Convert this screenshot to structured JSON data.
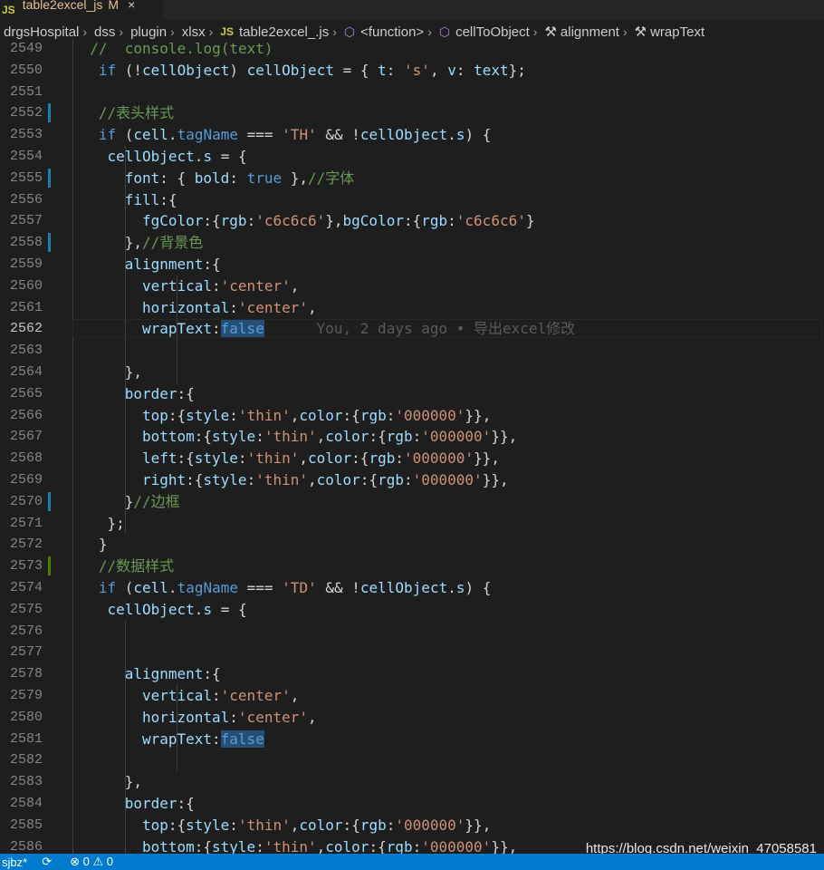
{
  "tab": {
    "badge": "JS",
    "file_name": "table2excel_js",
    "modified_flag": "M",
    "close_glyph": "×"
  },
  "breadcrumb": [
    {
      "label": "drgsHospital",
      "icon": ""
    },
    {
      "label": "dss",
      "icon": ""
    },
    {
      "label": "plugin",
      "icon": ""
    },
    {
      "label": "xlsx",
      "icon": ""
    },
    {
      "label": "table2excel_.js",
      "icon": "js-icon"
    },
    {
      "label": "<function>",
      "icon": "cube-icon"
    },
    {
      "label": "cellToObject",
      "icon": "cube-icon"
    },
    {
      "label": "alignment",
      "icon": "wrench-icon"
    },
    {
      "label": "wrapText",
      "icon": "wrench-icon"
    }
  ],
  "breadcrumb_js_badge": "JS",
  "active_line": "2562",
  "blame": "You, 2 days ago • 导出excel修改",
  "lines": [
    {
      "n": "2549",
      "t": [
        [
          "cmt",
          "//  console.log(text)"
        ]
      ]
    },
    {
      "n": "2550",
      "t": [
        [
          "kw",
          "if"
        ],
        [
          "pun",
          " (!"
        ],
        [
          "var",
          "cellObject"
        ],
        [
          "pun",
          ") "
        ],
        [
          "var",
          "cellObject"
        ],
        [
          "pun",
          " = { "
        ],
        [
          "var",
          "t"
        ],
        [
          "pun",
          ": "
        ],
        [
          "str",
          "'s'"
        ],
        [
          "pun",
          ", "
        ],
        [
          "var",
          "v"
        ],
        [
          "pun",
          ": "
        ],
        [
          "var",
          "text"
        ],
        [
          "pun",
          "};"
        ]
      ]
    },
    {
      "n": "2551",
      "t": []
    },
    {
      "n": "2552",
      "t": [
        [
          "cmt",
          "//表头样式"
        ]
      ]
    },
    {
      "n": "2553",
      "t": [
        [
          "kw",
          "if"
        ],
        [
          "pun",
          " ("
        ],
        [
          "var",
          "cell"
        ],
        [
          "pun",
          "."
        ],
        [
          "kw",
          "tagName"
        ],
        [
          "pun",
          " === "
        ],
        [
          "str",
          "'TH'"
        ],
        [
          "pun",
          " && !"
        ],
        [
          "var",
          "cellObject"
        ],
        [
          "pun",
          "."
        ],
        [
          "var",
          "s"
        ],
        [
          "pun",
          ") {"
        ]
      ]
    },
    {
      "n": "2554",
      "t": [
        [
          "var",
          "cellObject"
        ],
        [
          "pun",
          "."
        ],
        [
          "var",
          "s"
        ],
        [
          "pun",
          " = {"
        ]
      ]
    },
    {
      "n": "2555",
      "t": [
        [
          "var",
          "font"
        ],
        [
          "pun",
          ": { "
        ],
        [
          "var",
          "bold"
        ],
        [
          "pun",
          ": "
        ],
        [
          "kw",
          "true"
        ],
        [
          "pun",
          " },"
        ],
        [
          "cmt",
          "//字体"
        ]
      ]
    },
    {
      "n": "2556",
      "t": [
        [
          "var",
          "fill"
        ],
        [
          "pun",
          ":{"
        ]
      ]
    },
    {
      "n": "2557",
      "t": [
        [
          "var",
          "fgColor"
        ],
        [
          "pun",
          ":{"
        ],
        [
          "var",
          "rgb"
        ],
        [
          "pun",
          ":"
        ],
        [
          "str",
          "'c6c6c6'"
        ],
        [
          "pun",
          "},"
        ],
        [
          "var",
          "bgColor"
        ],
        [
          "pun",
          ":{"
        ],
        [
          "var",
          "rgb"
        ],
        [
          "pun",
          ":"
        ],
        [
          "str",
          "'c6c6c6'"
        ],
        [
          "pun",
          "}"
        ]
      ]
    },
    {
      "n": "2558",
      "t": [
        [
          "pun",
          "},"
        ],
        [
          "cmt",
          "//背景色"
        ]
      ]
    },
    {
      "n": "2559",
      "t": [
        [
          "var",
          "alignment"
        ],
        [
          "pun",
          ":{"
        ]
      ]
    },
    {
      "n": "2560",
      "t": [
        [
          "var",
          "vertical"
        ],
        [
          "pun",
          ":"
        ],
        [
          "str",
          "'center'"
        ],
        [
          "pun",
          ","
        ]
      ]
    },
    {
      "n": "2561",
      "t": [
        [
          "var",
          "horizontal"
        ],
        [
          "pun",
          ":"
        ],
        [
          "str",
          "'center'"
        ],
        [
          "pun",
          ","
        ]
      ]
    },
    {
      "n": "2562",
      "t": [
        [
          "var",
          "wrapText"
        ],
        [
          "pun",
          ":"
        ],
        [
          "selkw",
          "false"
        ]
      ]
    },
    {
      "n": "2563",
      "t": []
    },
    {
      "n": "2564",
      "t": [
        [
          "pun",
          "},"
        ]
      ]
    },
    {
      "n": "2565",
      "t": [
        [
          "var",
          "border"
        ],
        [
          "pun",
          ":{"
        ]
      ]
    },
    {
      "n": "2566",
      "t": [
        [
          "var",
          "top"
        ],
        [
          "pun",
          ":{"
        ],
        [
          "var",
          "style"
        ],
        [
          "pun",
          ":"
        ],
        [
          "str",
          "'thin'"
        ],
        [
          "pun",
          ","
        ],
        [
          "var",
          "color"
        ],
        [
          "pun",
          ":{"
        ],
        [
          "var",
          "rgb"
        ],
        [
          "pun",
          ":"
        ],
        [
          "str",
          "'000000'"
        ],
        [
          "pun",
          "}},"
        ]
      ]
    },
    {
      "n": "2567",
      "t": [
        [
          "var",
          "bottom"
        ],
        [
          "pun",
          ":{"
        ],
        [
          "var",
          "style"
        ],
        [
          "pun",
          ":"
        ],
        [
          "str",
          "'thin'"
        ],
        [
          "pun",
          ","
        ],
        [
          "var",
          "color"
        ],
        [
          "pun",
          ":{"
        ],
        [
          "var",
          "rgb"
        ],
        [
          "pun",
          ":"
        ],
        [
          "str",
          "'000000'"
        ],
        [
          "pun",
          "}},"
        ]
      ]
    },
    {
      "n": "2568",
      "t": [
        [
          "var",
          "left"
        ],
        [
          "pun",
          ":{"
        ],
        [
          "var",
          "style"
        ],
        [
          "pun",
          ":"
        ],
        [
          "str",
          "'thin'"
        ],
        [
          "pun",
          ","
        ],
        [
          "var",
          "color"
        ],
        [
          "pun",
          ":{"
        ],
        [
          "var",
          "rgb"
        ],
        [
          "pun",
          ":"
        ],
        [
          "str",
          "'000000'"
        ],
        [
          "pun",
          "}},"
        ]
      ]
    },
    {
      "n": "2569",
      "t": [
        [
          "var",
          "right"
        ],
        [
          "pun",
          ":{"
        ],
        [
          "var",
          "style"
        ],
        [
          "pun",
          ":"
        ],
        [
          "str",
          "'thin'"
        ],
        [
          "pun",
          ","
        ],
        [
          "var",
          "color"
        ],
        [
          "pun",
          ":{"
        ],
        [
          "var",
          "rgb"
        ],
        [
          "pun",
          ":"
        ],
        [
          "str",
          "'000000'"
        ],
        [
          "pun",
          "}},"
        ]
      ]
    },
    {
      "n": "2570",
      "t": [
        [
          "pun",
          "}"
        ],
        [
          "cmt",
          "//边框"
        ]
      ]
    },
    {
      "n": "2571",
      "t": [
        [
          "pun",
          "};"
        ]
      ]
    },
    {
      "n": "2572",
      "t": [
        [
          "pun",
          "}"
        ]
      ]
    },
    {
      "n": "2573",
      "t": [
        [
          "cmt",
          "//数据样式"
        ]
      ]
    },
    {
      "n": "2574",
      "t": [
        [
          "kw",
          "if"
        ],
        [
          "pun",
          " ("
        ],
        [
          "var",
          "cell"
        ],
        [
          "pun",
          "."
        ],
        [
          "kw",
          "tagName"
        ],
        [
          "pun",
          " === "
        ],
        [
          "str",
          "'TD'"
        ],
        [
          "pun",
          " && !"
        ],
        [
          "var",
          "cellObject"
        ],
        [
          "pun",
          "."
        ],
        [
          "var",
          "s"
        ],
        [
          "pun",
          ") {"
        ]
      ]
    },
    {
      "n": "2575",
      "t": [
        [
          "var",
          "cellObject"
        ],
        [
          "pun",
          "."
        ],
        [
          "var",
          "s"
        ],
        [
          "pun",
          " = {"
        ]
      ]
    },
    {
      "n": "2576",
      "t": []
    },
    {
      "n": "2577",
      "t": []
    },
    {
      "n": "2578",
      "t": [
        [
          "var",
          "alignment"
        ],
        [
          "pun",
          ":{"
        ]
      ]
    },
    {
      "n": "2579",
      "t": [
        [
          "var",
          "vertical"
        ],
        [
          "pun",
          ":"
        ],
        [
          "str",
          "'center'"
        ],
        [
          "pun",
          ","
        ]
      ]
    },
    {
      "n": "2580",
      "t": [
        [
          "var",
          "horizontal"
        ],
        [
          "pun",
          ":"
        ],
        [
          "str",
          "'center'"
        ],
        [
          "pun",
          ","
        ]
      ]
    },
    {
      "n": "2581",
      "t": [
        [
          "var",
          "wrapText"
        ],
        [
          "pun",
          ":"
        ],
        [
          "selkw",
          "false"
        ]
      ]
    },
    {
      "n": "2582",
      "t": []
    },
    {
      "n": "2583",
      "t": [
        [
          "pun",
          "},"
        ]
      ]
    },
    {
      "n": "2584",
      "t": [
        [
          "var",
          "border"
        ],
        [
          "pun",
          ":{"
        ]
      ]
    },
    {
      "n": "2585",
      "t": [
        [
          "var",
          "top"
        ],
        [
          "pun",
          ":{"
        ],
        [
          "var",
          "style"
        ],
        [
          "pun",
          ":"
        ],
        [
          "str",
          "'thin'"
        ],
        [
          "pun",
          ","
        ],
        [
          "var",
          "color"
        ],
        [
          "pun",
          ":{"
        ],
        [
          "var",
          "rgb"
        ],
        [
          "pun",
          ":"
        ],
        [
          "str",
          "'000000'"
        ],
        [
          "pun",
          "}},"
        ]
      ]
    },
    {
      "n": "2586",
      "t": [
        [
          "var",
          "bottom"
        ],
        [
          "pun",
          ":{"
        ],
        [
          "var",
          "style"
        ],
        [
          "pun",
          ":"
        ],
        [
          "str",
          "'thin'"
        ],
        [
          "pun",
          ","
        ],
        [
          "var",
          "color"
        ],
        [
          "pun",
          ":{"
        ],
        [
          "var",
          "rgb"
        ],
        [
          "pun",
          ":"
        ],
        [
          "str",
          "'000000'"
        ],
        [
          "pun",
          "}},"
        ]
      ]
    }
  ],
  "colors": {
    "keyword": "#569cd6",
    "variable": "#9cdcfe",
    "string": "#ce9178",
    "comment": "#6a9955",
    "status_bar": "#007acc",
    "gutter_modified": "#1b81a8",
    "gutter_added": "#487e02"
  },
  "statusbar": {
    "branch": "sjbz*",
    "sync_icon": "sync-icon",
    "errors": "0",
    "warnings": "0"
  },
  "watermark": "https://blog.csdn.net/weixin_47058581"
}
